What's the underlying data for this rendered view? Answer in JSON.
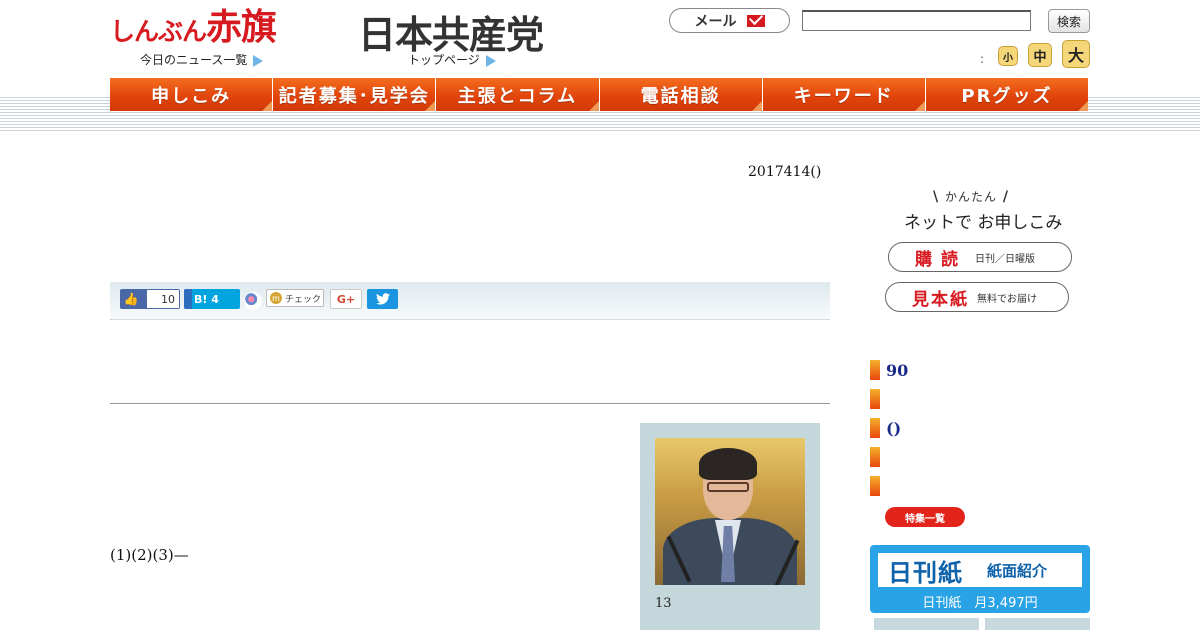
{
  "header": {
    "logo_kana": "しんぶん",
    "logo_kanji": "赤旗",
    "news_link": "今日のニュース一覧",
    "party_logo": "日本共産党",
    "top_link": "トップページ",
    "mail_label": "メール",
    "search_placeholder": "",
    "search_button": "検索",
    "size_colon": ":",
    "size_small": "小",
    "size_medium": "中",
    "size_large": "大"
  },
  "nav": {
    "items": [
      "申しこみ",
      "記者募集･見学会",
      "主張とコラム",
      "電話相談",
      "キーワード",
      "PRグッズ"
    ]
  },
  "article": {
    "date": "2017414()",
    "body": "(1)(2)(3)—",
    "photo_caption": "13"
  },
  "share": {
    "facebook_count": "10",
    "hatena_label": "B! 4",
    "mixi_check": "チェック",
    "gplus": "G+",
    "twitter_icon": "twitter-bird"
  },
  "sidebar": {
    "net_tag": "かんたん",
    "net_title": "ネットで お申しこみ",
    "subscribe_big": "購読",
    "subscribe_small": "日刊／日曜版",
    "sample_big": "見本紙",
    "sample_small": "無料でお届け",
    "features": [
      "90",
      "",
      "()",
      "",
      ""
    ],
    "feature_list_button": "特集一覧",
    "banner_title": "日刊紙",
    "banner_subtitle": "紙面紹介",
    "banner_price": "日刊紙　月3,497円"
  },
  "colors": {
    "brand_red": "#d71920",
    "nav_orange": "#e2450c",
    "banner_blue": "#2aa3e6",
    "feature_text": "#1a2a8a"
  }
}
